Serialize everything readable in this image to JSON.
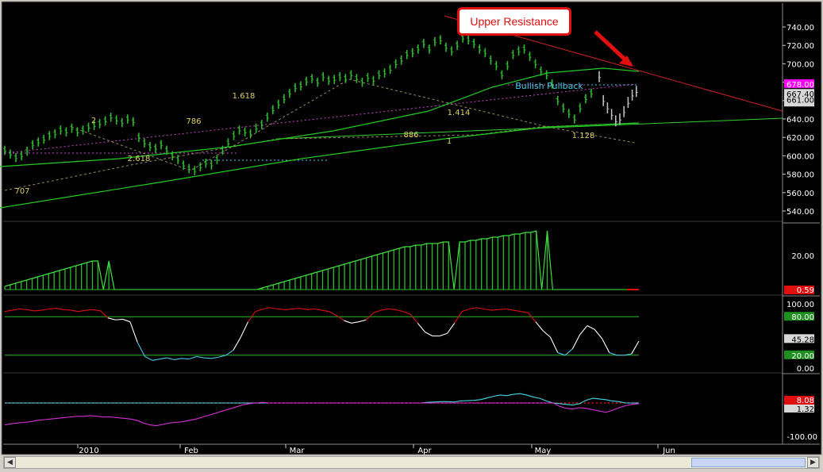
{
  "chart_data": {
    "type": "line",
    "price_panel": {
      "y_ticks": [
        "740.00",
        "720.00",
        "700.00",
        "680.00",
        "660.00",
        "640.00",
        "620.00",
        "600.00",
        "580.00",
        "560.00",
        "540.00"
      ],
      "y_range": [
        530,
        752
      ],
      "price_labels": {
        "high": "678.00",
        "current": "667.40",
        "low": "661.00",
        "high_color": "#ff00ff"
      },
      "fib_labels": [
        "1.618",
        "2",
        "786",
        "2.618",
        "707",
        "1.414",
        "886",
        "1",
        "1.128"
      ],
      "annotation": "Bullish Pullback",
      "callout": "Upper Resistance",
      "series": [
        {
          "kind": "ohlc",
          "values": [
            606,
            602,
            598,
            600,
            605,
            612,
            615,
            618,
            622,
            624,
            628,
            626,
            630,
            626,
            628,
            631,
            633,
            635,
            638,
            642,
            639,
            636,
            640,
            637,
            620,
            614,
            610,
            608,
            612,
            606,
            600,
            596,
            590,
            586,
            584,
            588,
            592,
            590,
            596,
            606,
            614,
            622,
            628,
            626,
            624,
            630,
            634,
            642,
            650,
            656,
            662,
            668,
            674,
            676,
            681,
            684,
            680,
            686,
            682,
            683,
            686,
            684,
            688,
            684,
            680,
            685,
            682,
            688,
            690,
            694,
            700,
            704,
            710,
            712,
            716,
            722,
            716,
            724,
            726,
            718,
            714,
            720,
            728,
            726,
            722,
            716,
            712,
            704,
            698,
            688,
            698,
            710,
            714,
            716,
            708,
            700,
            692,
            688,
            678,
            660,
            652,
            646,
            640,
            652,
            662,
            668
          ]
        },
        {
          "kind": "ohlc_gray",
          "values": [
            686,
            660,
            652,
            645,
            638,
            640,
            648,
            658,
            666,
            670
          ]
        }
      ]
    },
    "histogram_panel": {
      "y_tick": "20.00",
      "value_label": "0.59",
      "values": [
        2,
        3,
        4,
        5,
        6,
        7,
        8,
        9,
        10,
        11,
        12,
        13,
        14,
        15,
        16,
        17,
        18,
        18,
        0,
        18,
        0,
        0,
        0,
        0,
        0,
        0,
        0,
        0,
        0,
        0,
        0,
        0,
        0,
        0,
        0,
        0,
        0,
        0,
        0,
        0,
        0,
        0,
        0,
        0,
        0,
        0,
        0,
        1,
        2,
        3,
        4,
        5,
        6,
        7,
        8,
        9,
        10,
        11,
        12,
        13,
        14,
        15,
        16,
        17,
        18,
        19,
        20,
        21,
        22,
        23,
        24,
        25,
        26,
        27,
        27,
        28,
        28,
        29,
        29,
        29,
        30,
        30,
        0,
        30,
        30,
        31,
        31,
        32,
        32,
        33,
        33,
        34,
        34,
        35,
        35,
        36,
        36,
        37,
        0,
        37,
        0,
        0,
        0,
        0,
        0,
        0,
        0,
        0,
        0,
        0,
        0,
        0,
        0,
        0,
        0,
        0
      ]
    },
    "stoch_panel": {
      "y_ticks": [
        "100.00",
        "0.00"
      ],
      "levels": {
        "upper": "80.00",
        "lower": "20.00",
        "current": "45.28"
      },
      "values": [
        88,
        90,
        92,
        91,
        89,
        90,
        92,
        93,
        91,
        90,
        88,
        90,
        91,
        89,
        78,
        75,
        76,
        72,
        40,
        18,
        12,
        14,
        16,
        13,
        15,
        14,
        18,
        16,
        15,
        17,
        20,
        28,
        48,
        72,
        88,
        92,
        94,
        92,
        91,
        92,
        93,
        91,
        92,
        90,
        88,
        82,
        74,
        70,
        72,
        75,
        86,
        90,
        92,
        91,
        88,
        84,
        70,
        56,
        50,
        50,
        54,
        70,
        88,
        92,
        94,
        92,
        90,
        91,
        92,
        90,
        88,
        86,
        72,
        58,
        48,
        24,
        20,
        30,
        52,
        66,
        60,
        46,
        24,
        20,
        20,
        22,
        42
      ]
    },
    "osc_panel": {
      "y_tick": "-100.00",
      "labels": {
        "red": "8.08",
        "white": "1.32"
      },
      "cyan": [
        0,
        0,
        0,
        0,
        0,
        0,
        0,
        0,
        0,
        0,
        0,
        0,
        0,
        0,
        0,
        0,
        0,
        0,
        0,
        0,
        0,
        0,
        0,
        0,
        0,
        0,
        0,
        0,
        0,
        0,
        0,
        0,
        0,
        0,
        0,
        0,
        0,
        0,
        0,
        0,
        0,
        0,
        0,
        0,
        0,
        0,
        0,
        0,
        0,
        0,
        0,
        0,
        0,
        0,
        0,
        0,
        0,
        0,
        0,
        0,
        0,
        0,
        0,
        0,
        2,
        3,
        4,
        4,
        3,
        6,
        7,
        8,
        10,
        15,
        20,
        24,
        22,
        26,
        28,
        24,
        18,
        14,
        6,
        0,
        -2,
        -4,
        -6,
        -2,
        8,
        14,
        12,
        10,
        6,
        4,
        0,
        0,
        0
      ],
      "magenta": [
        -66,
        -62,
        -60,
        -58,
        -56,
        -52,
        -50,
        -48,
        -46,
        -44,
        -42,
        -40,
        -40,
        -38,
        -40,
        -42,
        -42,
        -44,
        -46,
        -48,
        -52,
        -60,
        -66,
        -68,
        -64,
        -60,
        -58,
        -56,
        -52,
        -48,
        -42,
        -36,
        -30,
        -24,
        -18,
        -12,
        -6,
        -2,
        0,
        2,
        0,
        0,
        0,
        0,
        0,
        0,
        0,
        0,
        0,
        0,
        0,
        0,
        0,
        0,
        0,
        0,
        0,
        0,
        0,
        0,
        0,
        0,
        0,
        0,
        0,
        0,
        0,
        0,
        0,
        0,
        0,
        0,
        0,
        0,
        0,
        0,
        0,
        0,
        0,
        0,
        0,
        0,
        0,
        0,
        -10,
        -16,
        -18,
        -14,
        -16,
        -20,
        -24,
        -28,
        -22,
        -14,
        -8,
        -4,
        -2
      ]
    },
    "x_ticks": [
      "2010",
      "Feb",
      "Mar",
      "Apr",
      "May",
      "Jun"
    ]
  }
}
